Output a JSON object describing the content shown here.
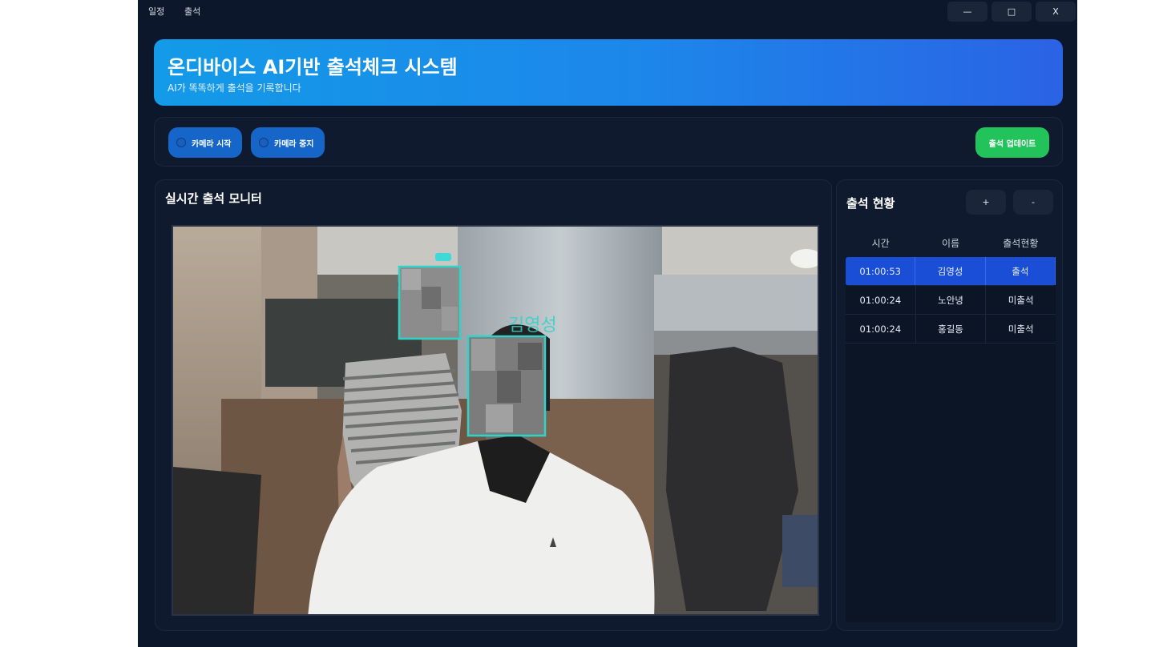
{
  "menu": {
    "items": [
      "일정",
      "출석"
    ]
  },
  "window_controls": {
    "minimize": "—",
    "maximize": "□",
    "close": "X"
  },
  "header": {
    "title": "온디바이스 AI기반 출석체크 시스템",
    "subtitle": "AI가 똑똑하게 출석을 기록합니다"
  },
  "toolbar": {
    "camera_start": "카메라 시작",
    "camera_stop": "카메라 중지",
    "update": "출석 업데이트"
  },
  "monitor": {
    "title": "실시간 출석 모니터",
    "detected_name": "김영성"
  },
  "status": {
    "title": "출석 현황",
    "add_label": "+",
    "remove_label": "-",
    "columns": [
      "시간",
      "이름",
      "출석현황"
    ],
    "rows": [
      {
        "time": "01:00:53",
        "name": "김영성",
        "state": "출석",
        "selected": true
      },
      {
        "time": "01:00:24",
        "name": "노안녕",
        "state": "미출석",
        "selected": false
      },
      {
        "time": "01:00:24",
        "name": "홍길동",
        "state": "미출석",
        "selected": false
      }
    ]
  },
  "colors": {
    "background": "#0d172b",
    "header_gradient_start": "#139ae8",
    "header_gradient_end": "#2a63e4",
    "camera_button": "#1566c8",
    "update_button": "#22c35a",
    "selected_row": "#1a4ed6",
    "face_box": "#2fd3c8"
  }
}
